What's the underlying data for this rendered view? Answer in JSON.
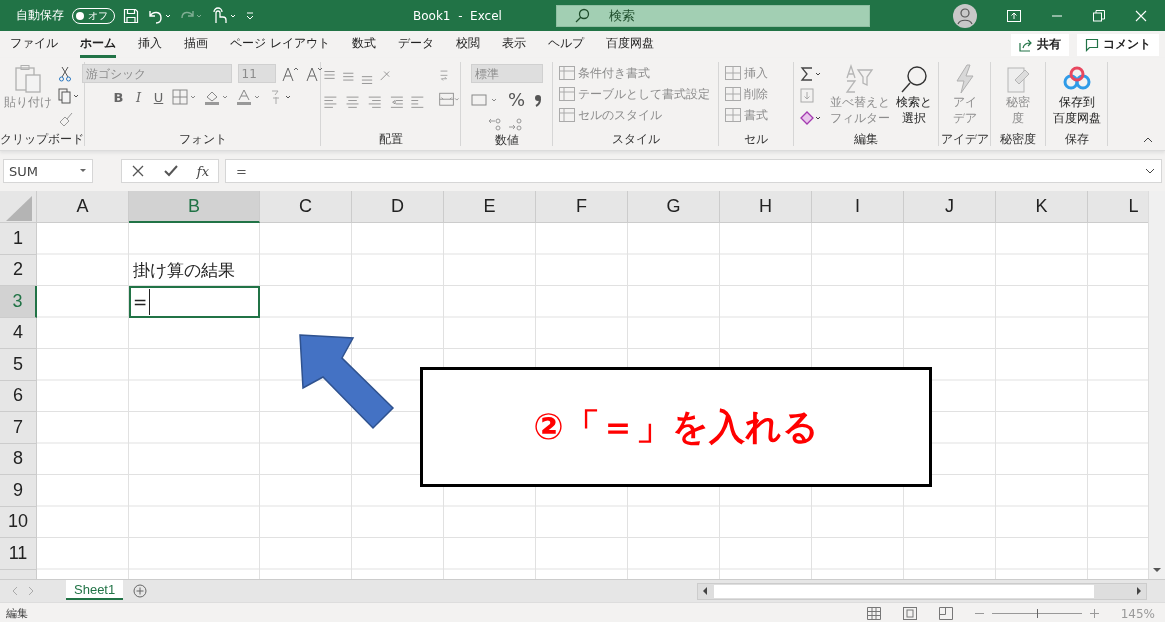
{
  "title_bar": {
    "autosave_label": "自動保存",
    "autosave_toggle": {
      "label": "オフ",
      "on": false
    },
    "title": "Book1  -  Excel",
    "search_placeholder": "検索"
  },
  "menu_tabs": [
    {
      "label": "ファイル",
      "selected": false
    },
    {
      "label": "ホーム",
      "selected": true
    },
    {
      "label": "挿入",
      "selected": false
    },
    {
      "label": "描画",
      "selected": false
    },
    {
      "label": "ページ レイアウト",
      "selected": false
    },
    {
      "label": "数式",
      "selected": false
    },
    {
      "label": "データ",
      "selected": false
    },
    {
      "label": "校閲",
      "selected": false
    },
    {
      "label": "表示",
      "selected": false
    },
    {
      "label": "ヘルプ",
      "selected": false
    },
    {
      "label": "百度网盘",
      "selected": false
    }
  ],
  "share_button": "共有",
  "comment_button": "コメント",
  "ribbon": {
    "clipboard": {
      "label": "クリップボード",
      "paste": {
        "label": "貼り付け",
        "disabled": true
      }
    },
    "font": {
      "label": "フォント",
      "font_name": {
        "value": "游ゴシック",
        "disabled": true
      },
      "font_size": {
        "value": "11",
        "disabled": true
      },
      "bold": "B",
      "italic": "I",
      "underline": "U"
    },
    "alignment": {
      "label": "配置"
    },
    "number": {
      "label": "数値",
      "format": {
        "value": "標準",
        "disabled": true
      },
      "percent": "%"
    },
    "styles": {
      "label": "スタイル",
      "items": [
        {
          "label": "条件付き書式",
          "disabled": true
        },
        {
          "label": "テーブルとして書式設定",
          "disabled": true
        },
        {
          "label": "セルのスタイル",
          "disabled": true
        }
      ]
    },
    "cells": {
      "label": "セル",
      "items": [
        {
          "label": "挿入",
          "disabled": true
        },
        {
          "label": "削除",
          "disabled": true
        },
        {
          "label": "書式",
          "disabled": true
        }
      ]
    },
    "editing": {
      "label": "編集",
      "sort": {
        "lines": [
          "並べ替えと",
          "フィルター"
        ],
        "disabled": true
      },
      "find": {
        "lines": [
          "検索と",
          "選択"
        ],
        "disabled": false
      }
    },
    "ideas": {
      "label": "アイデア",
      "button": {
        "lines": [
          "アイ",
          "デア"
        ],
        "disabled": true
      }
    },
    "sensitivity": {
      "label": "秘密度",
      "button": {
        "lines": [
          "秘密",
          "度"
        ],
        "disabled": true
      }
    },
    "save": {
      "label": "保存",
      "button": {
        "lines": [
          "保存到",
          "百度网盘"
        ],
        "disabled": false
      }
    }
  },
  "formula_bar": {
    "name_box": "SUM",
    "fx": "fx",
    "formula": "="
  },
  "grid": {
    "columns": [
      {
        "label": "A",
        "selected": false
      },
      {
        "label": "B",
        "selected": true
      },
      {
        "label": "C",
        "selected": false
      },
      {
        "label": "D",
        "selected": false
      },
      {
        "label": "E",
        "selected": false
      },
      {
        "label": "F",
        "selected": false
      },
      {
        "label": "G",
        "selected": false
      },
      {
        "label": "H",
        "selected": false
      },
      {
        "label": "I",
        "selected": false
      },
      {
        "label": "J",
        "selected": false
      },
      {
        "label": "K",
        "selected": false
      },
      {
        "label": "L",
        "selected": false
      }
    ],
    "rows": [
      {
        "label": "1",
        "selected": false
      },
      {
        "label": "2",
        "selected": false,
        "b": {
          "text": "掛け算の結果",
          "active": false
        }
      },
      {
        "label": "3",
        "selected": true,
        "b": {
          "text": "=",
          "active": true
        }
      },
      {
        "label": "4",
        "selected": false
      },
      {
        "label": "5",
        "selected": false
      },
      {
        "label": "6",
        "selected": false
      },
      {
        "label": "7",
        "selected": false
      },
      {
        "label": "8",
        "selected": false
      },
      {
        "label": "9",
        "selected": false
      },
      {
        "label": "10",
        "selected": false
      },
      {
        "label": "11",
        "selected": false
      }
    ]
  },
  "sheet_tabs": [
    {
      "label": "Sheet1",
      "selected": true
    }
  ],
  "status_bar": {
    "mode": "編集",
    "zoom": {
      "level": 0.5,
      "reading": "145%"
    }
  },
  "annotation": {
    "text": "②「＝」を入れる"
  }
}
